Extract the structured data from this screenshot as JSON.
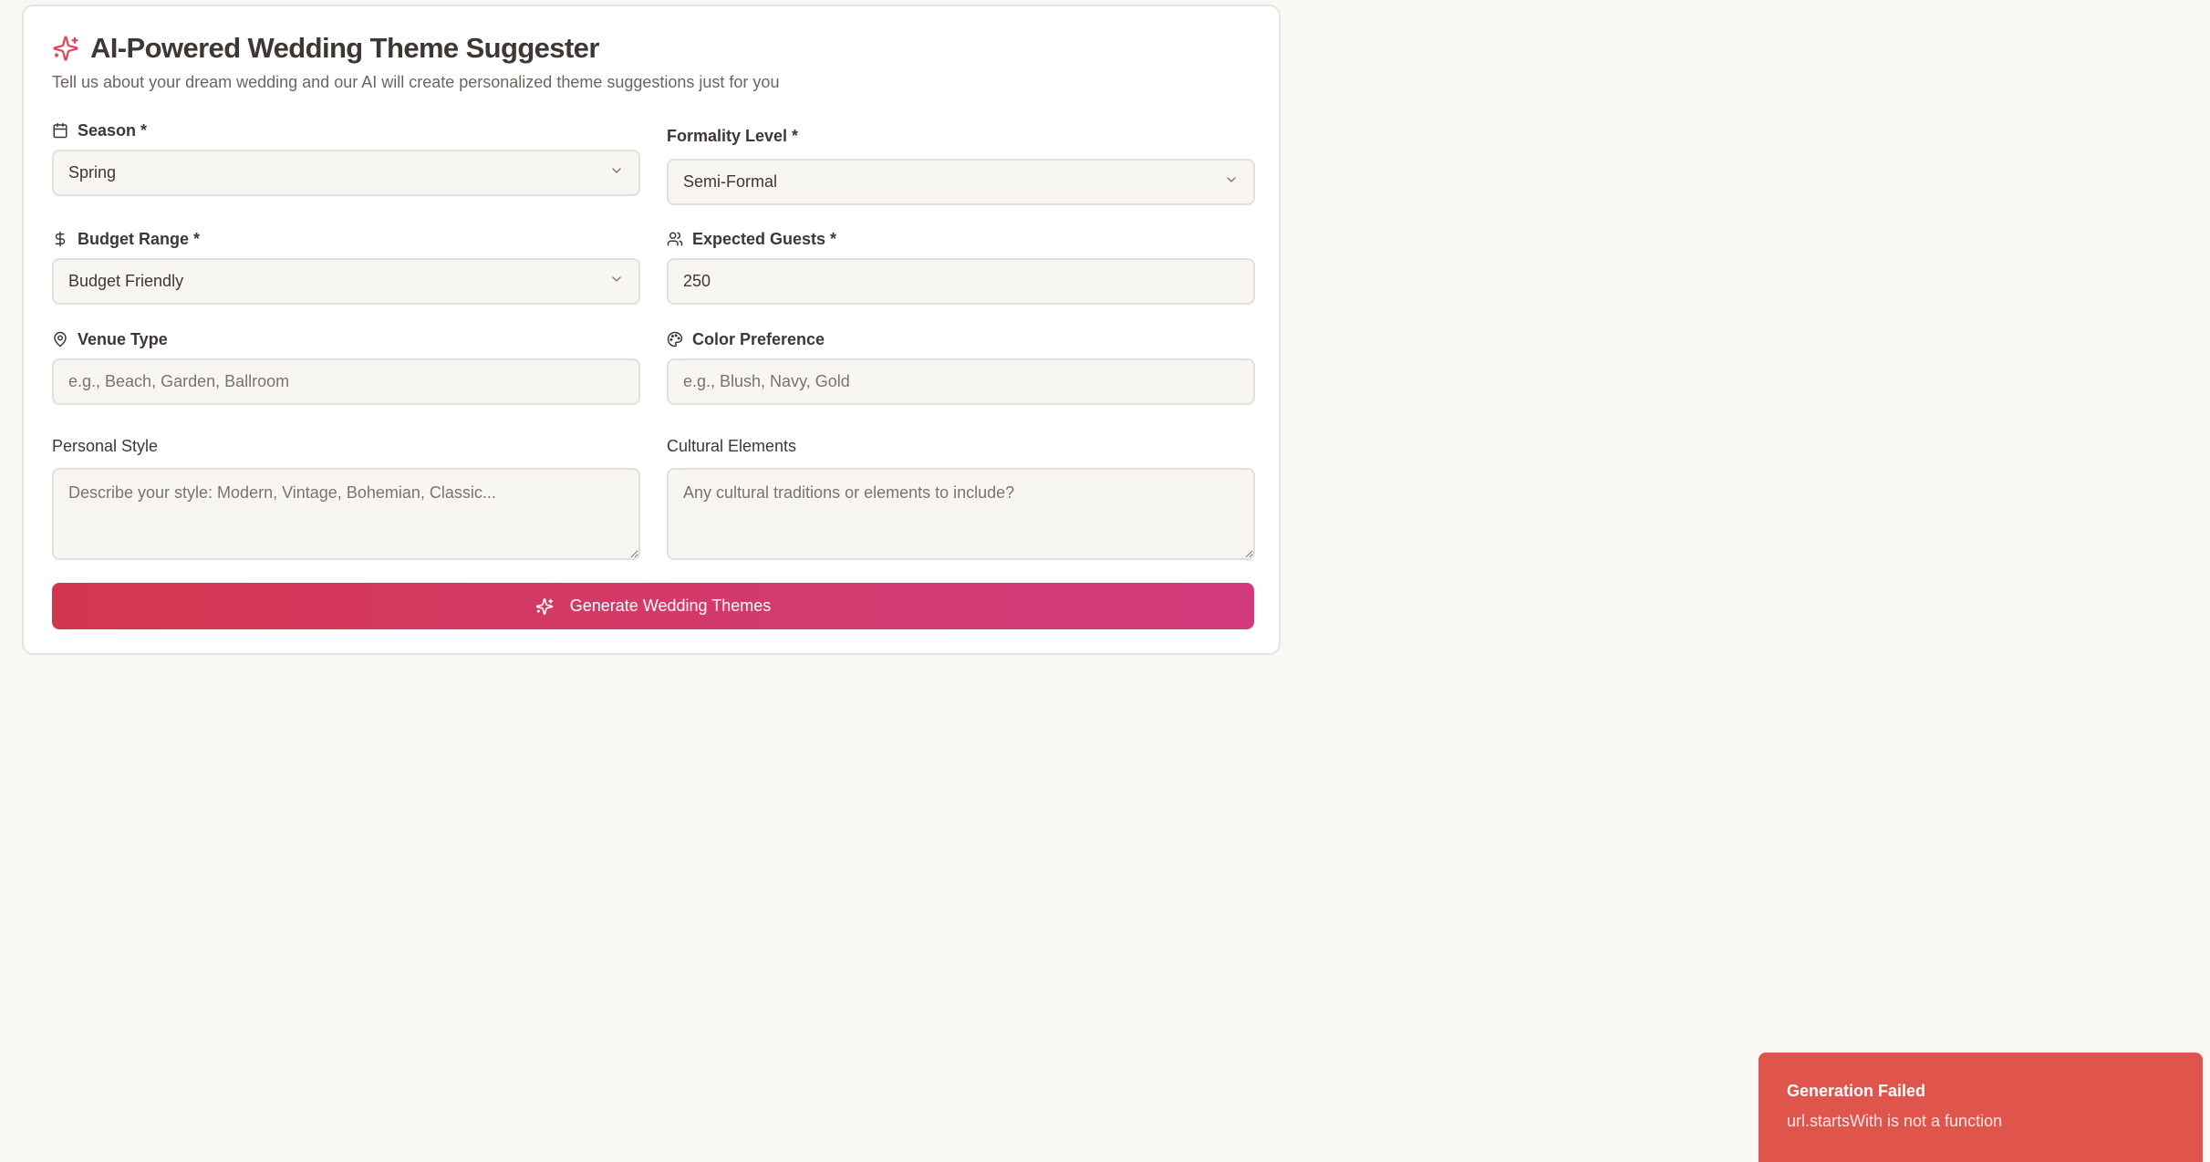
{
  "header": {
    "title": "AI-Powered Wedding Theme Suggester",
    "subtitle": "Tell us about your dream wedding and our AI will create personalized theme suggestions just for you",
    "icon": "sparkles-icon"
  },
  "form": {
    "season": {
      "label": "Season *",
      "value": "Spring",
      "icon": "calendar-icon"
    },
    "formality": {
      "label": "Formality Level *",
      "value": "Semi-Formal"
    },
    "budget": {
      "label": "Budget Range *",
      "value": "Budget Friendly",
      "icon": "dollar-icon"
    },
    "guests": {
      "label": "Expected Guests *",
      "value": "250",
      "icon": "users-icon"
    },
    "venue": {
      "label": "Venue Type",
      "placeholder": "e.g., Beach, Garden, Ballroom",
      "icon": "map-pin-icon"
    },
    "color": {
      "label": "Color Preference",
      "placeholder": "e.g., Blush, Navy, Gold",
      "icon": "palette-icon"
    },
    "style": {
      "label": "Personal Style",
      "placeholder": "Describe your style: Modern, Vintage, Bohemian, Classic..."
    },
    "cultural": {
      "label": "Cultural Elements",
      "placeholder": "Any cultural traditions or elements to include?"
    },
    "submit_label": "Generate Wedding Themes"
  },
  "toast": {
    "title": "Generation Failed",
    "message": "url.startsWith is not a function",
    "color": "#e0554b"
  },
  "colors": {
    "accent": "#d3374f",
    "accent_end": "#d23a7d",
    "background": "#f9f8f5"
  }
}
